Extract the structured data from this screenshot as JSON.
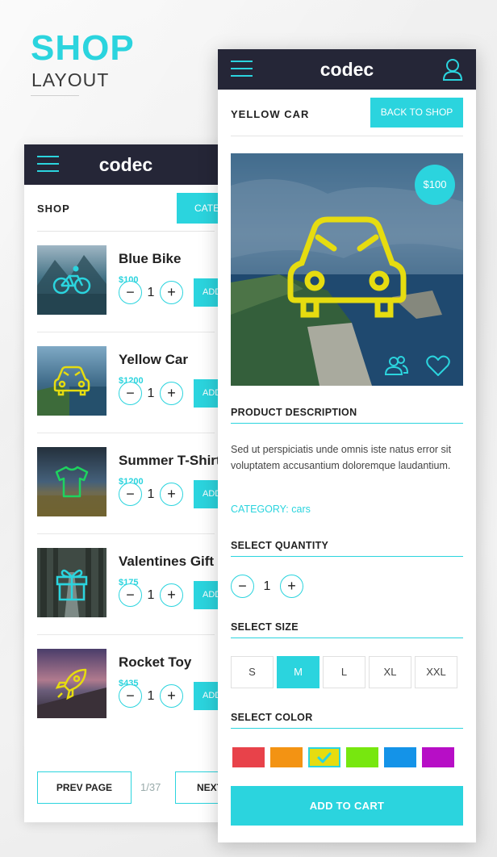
{
  "hero": {
    "title": "SHOP",
    "subtitle": "LAYOUT"
  },
  "back_screen": {
    "logo": "codec",
    "header_title": "SHOP",
    "category_button": "CATE",
    "products": [
      {
        "name": "Blue Bike",
        "price": "$100",
        "qty": "1",
        "add": "ADD",
        "icon": "bike-icon"
      },
      {
        "name": "Yellow Car",
        "price": "$1200",
        "qty": "1",
        "add": "ADD",
        "icon": "car-icon"
      },
      {
        "name": "Summer T-Shirt",
        "price": "$1200",
        "qty": "1",
        "add": "ADD",
        "icon": "tshirt-icon"
      },
      {
        "name": "Valentines Gift",
        "price": "$175",
        "qty": "1",
        "add": "ADD",
        "icon": "gift-icon"
      },
      {
        "name": "Rocket Toy",
        "price": "$435",
        "qty": "1",
        "add": "ADD",
        "icon": "rocket-icon"
      }
    ],
    "pager": {
      "prev": "PREV PAGE",
      "count": "1/37",
      "next": "NEXT"
    }
  },
  "front_screen": {
    "logo": "codec",
    "title": "YELLOW CAR",
    "back_button": "BACK TO SHOP",
    "price": "$100",
    "description_heading": "PRODUCT DESCRIPTION",
    "description": "Sed ut perspiciatis unde omnis iste natus error sit voluptatem accusantium doloremque laudantium.",
    "category": "CATEGORY: cars",
    "quantity_heading": "SELECT QUANTITY",
    "quantity": "1",
    "size_heading": "SELECT SIZE",
    "sizes": [
      "S",
      "M",
      "L",
      "XL",
      "XXL"
    ],
    "selected_size": "M",
    "color_heading": "SELECT COLOR",
    "colors": [
      "#e8424a",
      "#f39313",
      "#e6dc10",
      "#77e70f",
      "#1493e8",
      "#b70ec6"
    ],
    "selected_color": "#e6dc10",
    "add_to_cart": "ADD TO CART"
  },
  "accent": "#2bd4de",
  "appbar_color": "#252637"
}
